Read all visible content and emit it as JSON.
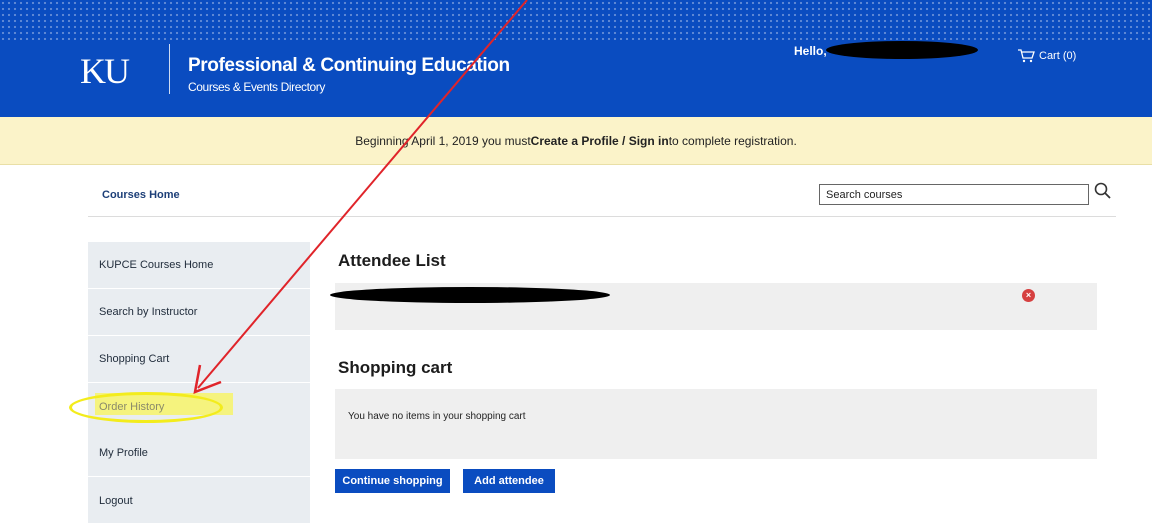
{
  "header": {
    "logo_text": "KU",
    "title": "Professional & Continuing Education",
    "subtitle": "Courses & Events Directory",
    "greeting": "Hello,",
    "cart_label": "Cart (0)"
  },
  "notice": {
    "prefix": "Beginning April 1, 2019 you must ",
    "link_text": "Create a Profile / Sign in",
    "suffix": " to complete registration."
  },
  "nav": {
    "courses_home": "Courses Home",
    "search_placeholder": "Search courses"
  },
  "sidebar": {
    "items": [
      {
        "label": "KUPCE Courses Home"
      },
      {
        "label": "Search by Instructor"
      },
      {
        "label": "Shopping Cart"
      },
      {
        "label": "Order History"
      },
      {
        "label": "My Profile"
      },
      {
        "label": "Logout"
      }
    ]
  },
  "main": {
    "attendee_heading": "Attendee List",
    "cart_heading": "Shopping cart",
    "cart_empty": "You have no items in your shopping cart",
    "continue_button": "Continue shopping",
    "add_attendee_button": "Add attendee"
  },
  "colors": {
    "brand_blue": "#0a4cc0",
    "notice_bg": "#fbf3c9",
    "sidebar_bg": "#e9edf1",
    "annotation_red": "#e0242a",
    "highlight_yellow": "#f3ec1c"
  }
}
